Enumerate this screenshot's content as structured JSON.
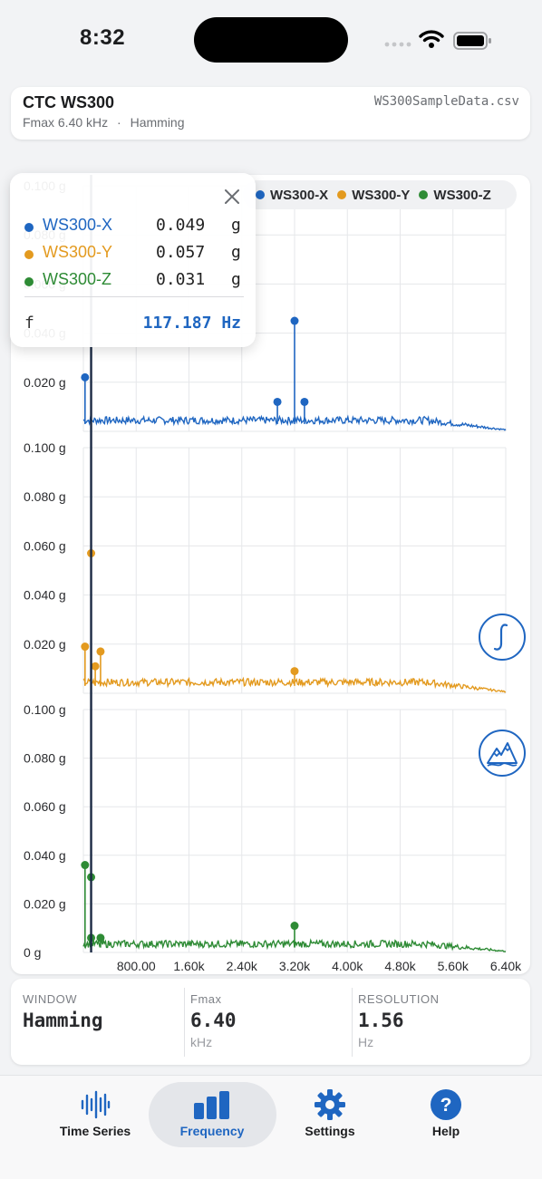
{
  "status_bar": {
    "time": "8:32"
  },
  "header": {
    "device_name": "CTC WS300",
    "fmax_text": "Fmax 6.40 kHz",
    "separator": "·",
    "window_text": "Hamming",
    "file_name": "WS300SampleData.csv"
  },
  "legend": {
    "items": [
      {
        "name": "WS300-X",
        "color": "#1f66c1"
      },
      {
        "name": "WS300-Y",
        "color": "#e39a1f"
      },
      {
        "name": "WS300-Z",
        "color": "#2e8b35"
      }
    ]
  },
  "tooltip": {
    "rows": [
      {
        "name": "WS300-X",
        "value": "0.049",
        "unit": "g",
        "color": "#1f66c1"
      },
      {
        "name": "WS300-Y",
        "value": "0.057",
        "unit": "g",
        "color": "#e39a1f"
      },
      {
        "name": "WS300-Z",
        "value": "0.031",
        "unit": "g",
        "color": "#2e8b35"
      }
    ],
    "f_label": "f",
    "f_value": "117.187 Hz"
  },
  "chart_data": {
    "type": "line",
    "x_unit": "Hz",
    "x_range": [
      0,
      6400
    ],
    "x_ticks": [
      "800.00",
      "1.60k",
      "2.40k",
      "3.20k",
      "4.00k",
      "4.80k",
      "5.60k",
      "6.40k"
    ],
    "y_unit": "g",
    "y_range": [
      0,
      0.1
    ],
    "panels": [
      {
        "name": "WS300-X",
        "color": "#1f66c1",
        "y_ticks": [
          "0.020 g",
          "0.040 g",
          "0.060 g",
          "0.080 g",
          "0.100 g"
        ],
        "noise_floor": 0.003,
        "noise_amplitude": 0.003,
        "peaks": [
          {
            "x": 25,
            "y": 0.022
          },
          {
            "x": 2940,
            "y": 0.012
          },
          {
            "x": 3200,
            "y": 0.045
          },
          {
            "x": 3350,
            "y": 0.012
          }
        ]
      },
      {
        "name": "WS300-Y",
        "color": "#e39a1f",
        "y_ticks": [
          "0.020 g",
          "0.040 g",
          "0.060 g",
          "0.080 g",
          "0.100 g"
        ],
        "noise_floor": 0.003,
        "noise_amplitude": 0.003,
        "peaks": [
          {
            "x": 25,
            "y": 0.019
          },
          {
            "x": 117.187,
            "y": 0.057
          },
          {
            "x": 180,
            "y": 0.011
          },
          {
            "x": 260,
            "y": 0.017
          },
          {
            "x": 3200,
            "y": 0.009
          }
        ]
      },
      {
        "name": "WS300-Z",
        "color": "#2e8b35",
        "y_ticks": [
          "0 g",
          "0.020 g",
          "0.040 g",
          "0.060 g",
          "0.080 g",
          "0.100 g"
        ],
        "noise_floor": 0.002,
        "noise_amplitude": 0.003,
        "peaks": [
          {
            "x": 25,
            "y": 0.036
          },
          {
            "x": 117.187,
            "y": 0.031
          },
          {
            "x": 117.187,
            "y": 0.006
          },
          {
            "x": 260,
            "y": 0.006
          },
          {
            "x": 3200,
            "y": 0.011
          }
        ]
      }
    ],
    "cursor_x": 117.187,
    "grid": true
  },
  "info": {
    "window_label": "WINDOW",
    "window_value": "Hamming",
    "fmax_label": "Fmax",
    "fmax_value": "6.40",
    "fmax_unit": "kHz",
    "resolution_label": "RESOLUTION",
    "resolution_value": "1.56",
    "resolution_unit": "Hz"
  },
  "tabs": [
    {
      "label": "Time Series",
      "icon": "waveform-icon",
      "active": false
    },
    {
      "label": "Frequency",
      "icon": "bar-chart-icon",
      "active": true
    },
    {
      "label": "Settings",
      "icon": "gear-icon",
      "active": false
    },
    {
      "label": "Help",
      "icon": "question-icon",
      "active": false
    }
  ],
  "side_buttons": [
    {
      "icon": "integral-icon"
    },
    {
      "icon": "peaks-icon"
    }
  ]
}
